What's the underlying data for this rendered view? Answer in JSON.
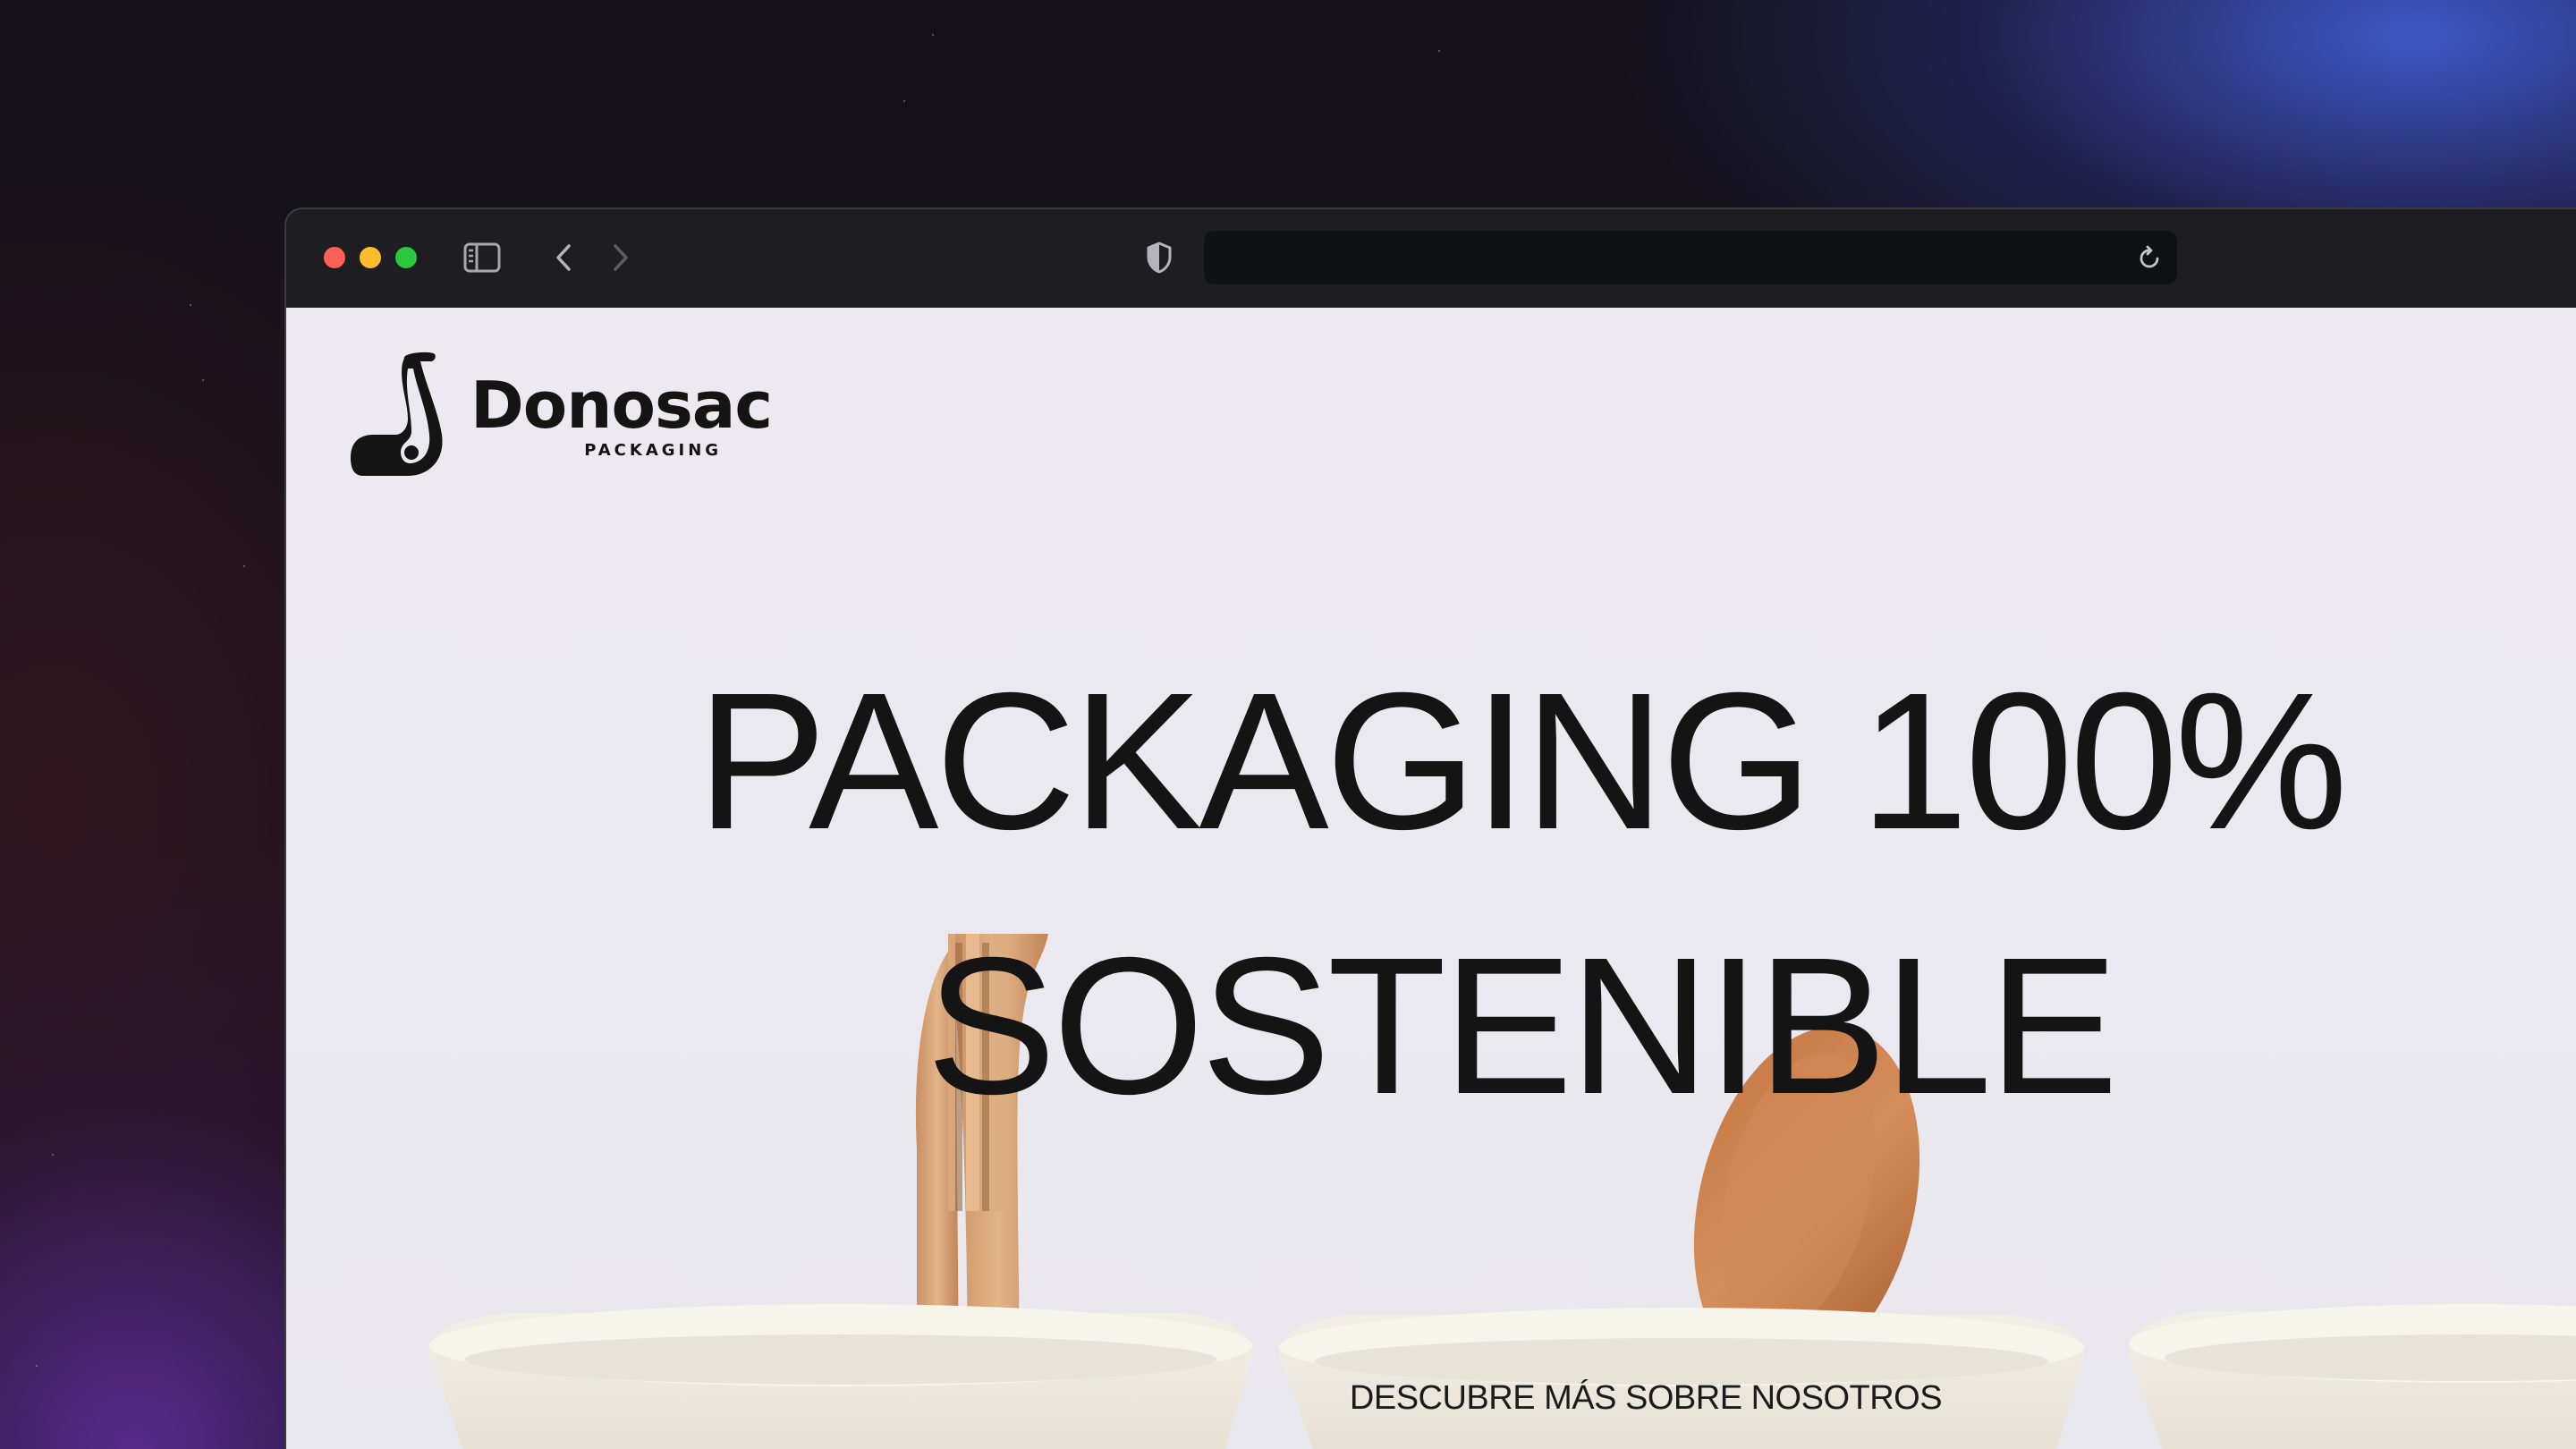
{
  "browser": {
    "url": "",
    "icons": {
      "sidebar": "sidebar-icon",
      "back": "chevron-left-icon",
      "forward": "chevron-right-icon",
      "privacy": "shield-icon",
      "reload": "reload-icon"
    }
  },
  "site": {
    "brand": "Donosac",
    "brand_sub": "PACKAGING",
    "hero_line1": "PACKAGING 100%",
    "hero_line2": "SOSTENIBLE",
    "cta": "DESCUBRE MÁS SOBRE NOSOTROS"
  },
  "colors": {
    "page_bg": "#ebe9f0",
    "text": "#141414",
    "toolbar": "#1e1d22",
    "close": "#fe5f57",
    "minimize": "#febc2e",
    "zoom": "#28c840"
  }
}
